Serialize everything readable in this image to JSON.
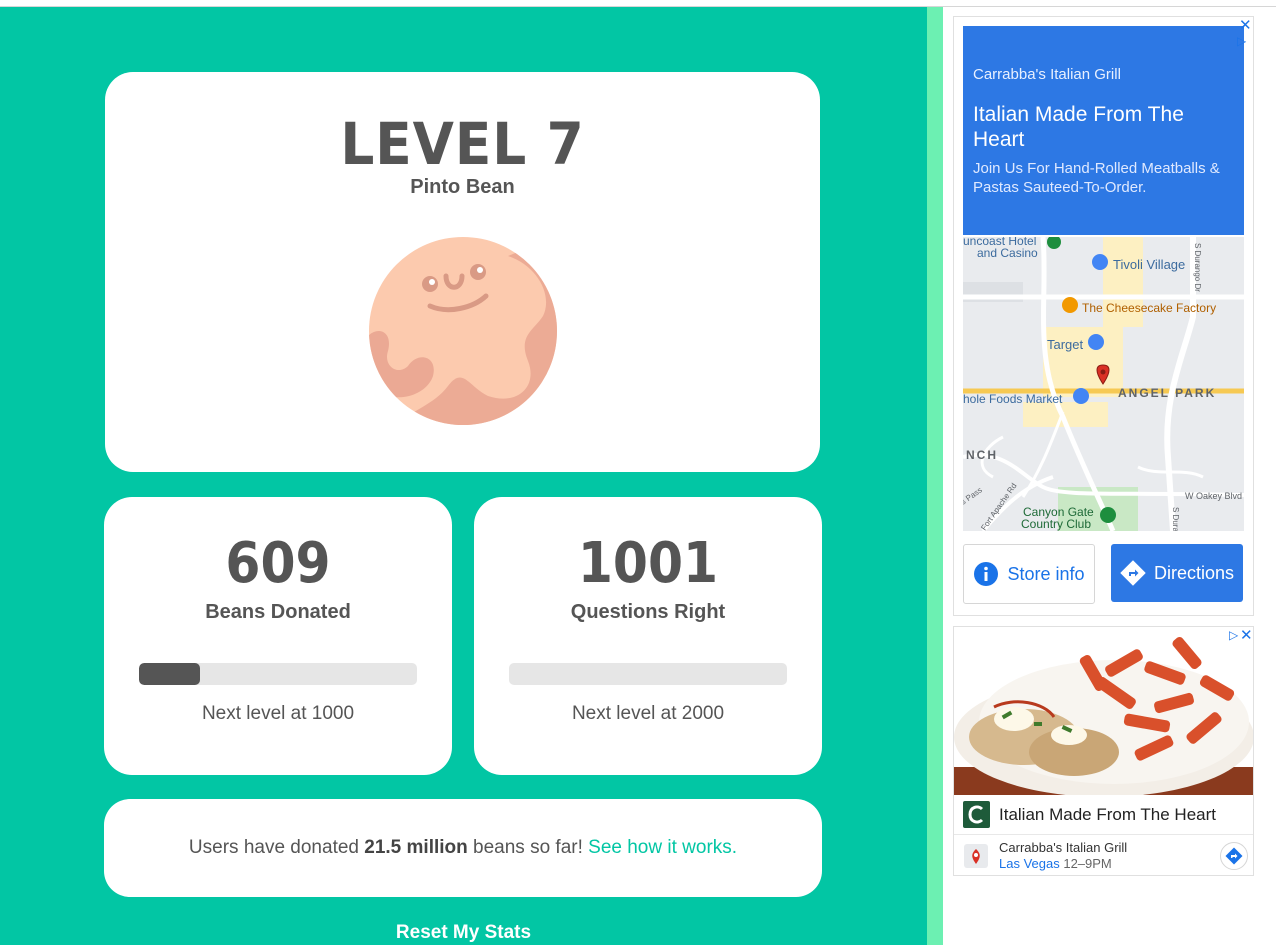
{
  "level": {
    "title": "LEVEL 7",
    "bean_name": "Pinto Bean"
  },
  "stats": [
    {
      "number": "609",
      "label": "Beans Donated",
      "progress": 0.22,
      "next_label": "Next level at 1000"
    },
    {
      "number": "1001",
      "label": "Questions Right",
      "progress": 0.0,
      "next_label": "Next level at 2000"
    }
  ],
  "info": {
    "prefix": "Users have donated ",
    "highlight": "21.5 million",
    "suffix": " beans so far! ",
    "link": "See how it works."
  },
  "reset_label": "Reset My Stats",
  "ad1": {
    "brand": "Carrabba's Italian Grill",
    "headline": "Italian Made From The Heart",
    "body": "Join Us For Hand-Rolled Meatballs & Pastas Sauteed-To-Order.",
    "close_icon": "close-icon",
    "map_labels": {
      "suncoast": "uncoast Hotel",
      "suncoast2": "and Casino",
      "tivoli": "Tivoli Village",
      "cheesecake": "The Cheesecake Factory",
      "target": "Target",
      "wholefoods": "hole Foods Market",
      "angel_park": "ANGEL PARK",
      "nch": "NCH",
      "canyon1": "Canyon Gate",
      "canyon2": "Country Club",
      "oakey": "W Oakey Blvd",
      "durango": "S Durango Dr",
      "apache": "Fort Apache Rd",
      "pass": "s Pass",
      "dura2": "S Dura"
    },
    "store_info": "Store info",
    "directions": "Directions"
  },
  "ad2": {
    "title": "Italian Made From The Heart",
    "name": "Carrabba's Italian Grill",
    "location": "Las Vegas",
    "hours": "12–9PM"
  },
  "colors": {
    "page_bg": "#02c6a4",
    "stripe": "#6cf0b2",
    "text_dark": "#555555",
    "link": "#02c6a4",
    "ad_blue": "#2d78e4"
  }
}
